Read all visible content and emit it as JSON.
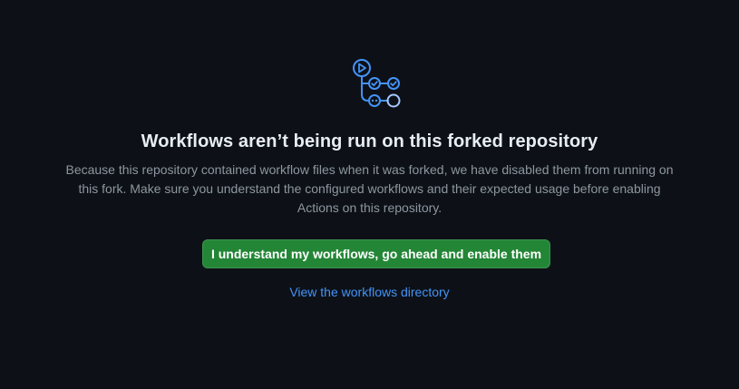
{
  "blankslate": {
    "icon": "workflow-icon",
    "title": "Workflows aren’t being run on this forked repository",
    "description": "Because this repository contained workflow files when it was forked, we have disabled them from running on this fork. Make sure you understand the configured workflows and their expected usage before enabling Actions on this repository.",
    "enable_button_label": "I understand my workflows, go ahead and enable them",
    "directory_link_label": "View the workflows directory"
  },
  "colors": {
    "background": "#0d1117",
    "primary_button": "#238636",
    "link": "#4493f8",
    "icon_accent": "#4493f8"
  }
}
